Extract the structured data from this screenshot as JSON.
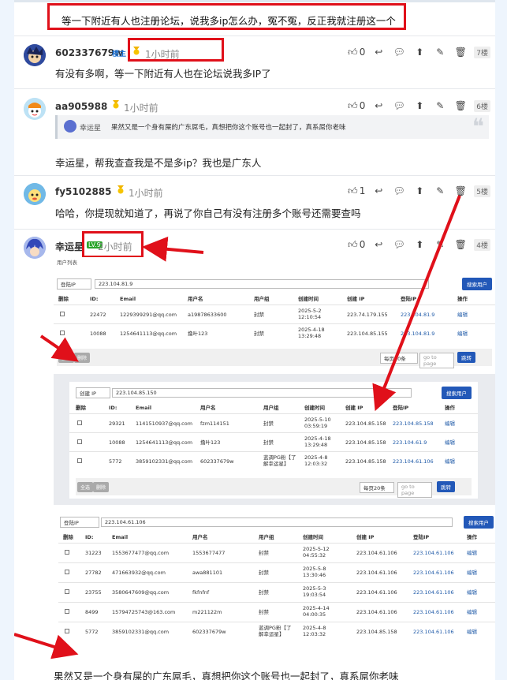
{
  "top_quote": "等一下附近有人也注册论坛，说我多ip怎么办，冤不冤，反正我就注册这一个",
  "posts": [
    {
      "user": "602337679w",
      "badge": "楼主",
      "time": "1小时前",
      "likes": "0",
      "floor": "7楼",
      "text": "有没有多啊，等一下附近有人也在论坛说我多IP了"
    },
    {
      "user": "aa905988",
      "time": "1小时前",
      "likes": "0",
      "floor": "6楼",
      "quote_user": "幸运星",
      "quote_text": "果然又是一个身有屎的广东屌毛，真想把你这个账号也一起封了，真系屌你老味",
      "text": "幸运星，帮我查查我是不是多ip？我也是广东人"
    },
    {
      "user": "fy5102885",
      "time": "1小时前",
      "likes": "1",
      "floor": "5楼",
      "text": "哈哈，你提现就知道了，再说了你自己有没有注册多个账号还需要查吗"
    },
    {
      "user": "幸运星",
      "level": "LV.9",
      "time": "2小时前",
      "likes": "0",
      "floor": "4楼"
    }
  ],
  "shots": [
    {
      "list_title": "用户列表",
      "filter": "登陆IP",
      "ip": "223.104.81.9",
      "search": "搜索用户",
      "headers": [
        "删除",
        "ID:",
        "Email",
        "用户名",
        "用户组",
        "创建时间",
        "创建 IP",
        "登陆IP",
        "操作"
      ],
      "rows": [
        [
          "22472",
          "1229399291@qq.com",
          "a19878633600",
          "封禁",
          "2025-5-2\n12:10:54",
          "223.74.179.155",
          "223.104.81.9",
          "编辑"
        ],
        [
          "10088",
          "1254641113@qq.com",
          "撸叶123",
          "封禁",
          "2025-4-18\n13:29:48",
          "223.104.85.155",
          "223.104.81.9",
          "编辑"
        ]
      ],
      "select_all": "全选",
      "delete": "删除",
      "per_page": "每页20条",
      "goto": "go to page",
      "jump": "跳转"
    },
    {
      "filter": "创建 IP",
      "ip": "223.104.85.150",
      "search": "搜索用户",
      "headers": [
        "删除",
        "ID:",
        "Email",
        "用户名",
        "用户组",
        "创建时间",
        "创建 IP",
        "登陆IP",
        "操作"
      ],
      "rows": [
        [
          "29321",
          "1141510937@qq.com",
          "fzm114151",
          "封禁",
          "2025-5-10\n03:59:19",
          "223.104.85.158",
          "223.104.85.158",
          "编辑"
        ],
        [
          "10088",
          "1254641113@qq.com",
          "撸叶123",
          "封禁",
          "2025-4-18\n13:29:48",
          "223.104.85.158",
          "223.104.61.9",
          "编辑"
        ],
        [
          "5772",
          "3859102331@qq.com",
          "602337679w",
          "蓝调PG粉【了解幸运星】",
          "2025-4-8\n12:03:32",
          "223.104.85.158",
          "223.104.61.106",
          "编辑"
        ]
      ],
      "select_all": "全选",
      "delete": "删除",
      "per_page": "每页20条",
      "goto": "go to page",
      "jump": "跳转"
    },
    {
      "filter": "登陆IP",
      "ip": "223.104.61.106",
      "search": "搜索用户",
      "headers": [
        "删除",
        "ID:",
        "Email",
        "用户名",
        "用户组",
        "创建时间",
        "创建 IP",
        "登陆IP",
        "操作"
      ],
      "rows": [
        [
          "31223",
          "1553677477@qq.com",
          "1553677477",
          "封禁",
          "2025-5-12\n04:55:32",
          "223.104.61.106",
          "223.104.61.106",
          "编辑"
        ],
        [
          "27782",
          "471663932@qq.com",
          "awa881101",
          "封禁",
          "2025-5-8\n13:30:46",
          "223.104.61.106",
          "223.104.61.106",
          "编辑"
        ],
        [
          "23755",
          "3580647609@qq.com",
          "fkfnfnf",
          "封禁",
          "2025-5-3\n19:03:54",
          "223.104.61.106",
          "223.104.61.106",
          "编辑"
        ],
        [
          "8499",
          "15794725743@163.com",
          "m221122m",
          "封禁",
          "2025-4-14\n04:00:35",
          "223.104.61.106",
          "223.104.61.106",
          "编辑"
        ],
        [
          "5772",
          "3859102331@qq.com",
          "602337679w",
          "蓝调PG粉【了解幸运星】",
          "2025-4-8\n12:03:32",
          "223.104.85.158",
          "223.104.61.106",
          "编辑"
        ]
      ]
    }
  ],
  "footer_text": "果然又是一个身有屎的广东屌毛，真想把你这个账号也一起封了，真系屌你老味",
  "colors": {
    "accent": "#2258b8",
    "highlight": "#e0101a",
    "link": "#1f5aa8"
  }
}
